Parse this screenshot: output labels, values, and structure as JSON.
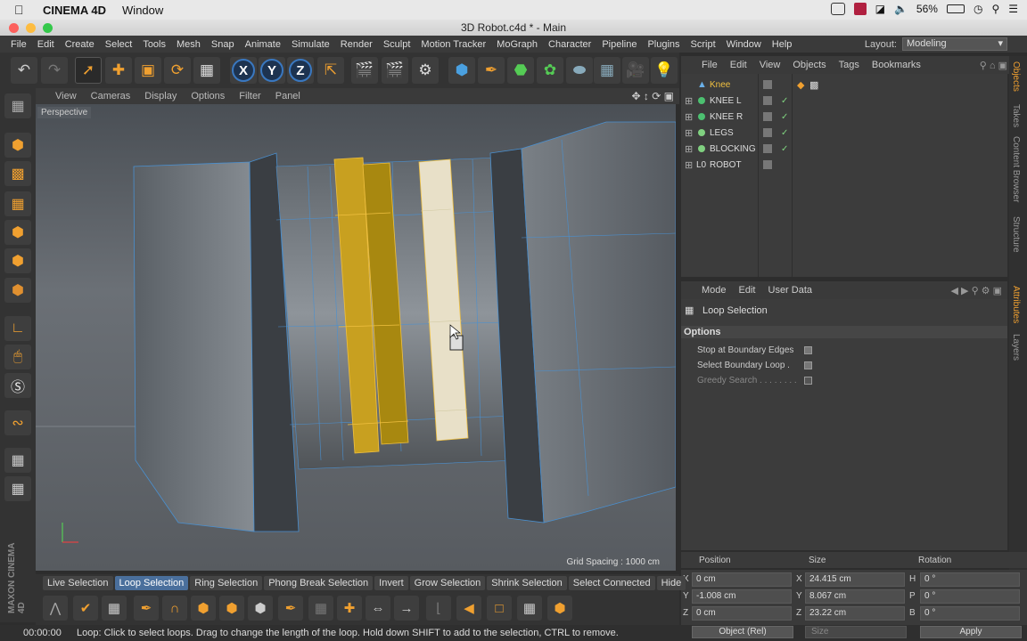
{
  "mac": {
    "app": "CINEMA 4D",
    "menu": "Window",
    "battery": "56%"
  },
  "window": {
    "title": "3D Robot.c4d * - Main"
  },
  "menu": [
    "File",
    "Edit",
    "Create",
    "Select",
    "Tools",
    "Mesh",
    "Snap",
    "Animate",
    "Simulate",
    "Render",
    "Sculpt",
    "Motion Tracker",
    "MoGraph",
    "Character",
    "Pipeline",
    "Plugins",
    "Script",
    "Window",
    "Help"
  ],
  "layout": {
    "label": "Layout:",
    "value": "Modeling"
  },
  "axis": {
    "x": "X",
    "y": "Y",
    "z": "Z"
  },
  "viewport": {
    "menu": [
      "View",
      "Cameras",
      "Display",
      "Options",
      "Filter",
      "Panel"
    ],
    "camera_label": "Perspective",
    "grid_spacing": "Grid Spacing : 1000 cm"
  },
  "objects": {
    "menu": [
      "File",
      "Edit",
      "View",
      "Objects",
      "Tags",
      "Bookmarks"
    ],
    "items": [
      {
        "name": "Knee",
        "color": "#f0c040"
      },
      {
        "name": "KNEE L",
        "color": "#ddd"
      },
      {
        "name": "KNEE R",
        "color": "#ddd"
      },
      {
        "name": "LEGS",
        "color": "#ddd"
      },
      {
        "name": "BLOCKING",
        "color": "#ddd"
      },
      {
        "name": "ROBOT",
        "color": "#ddd"
      }
    ]
  },
  "side_tabs": [
    "Objects",
    "Takes",
    "Content Browser",
    "Structure",
    "Attributes",
    "Layers"
  ],
  "attributes": {
    "menu": [
      "Mode",
      "Edit",
      "User Data"
    ],
    "tool_name": "Loop Selection",
    "section": "Options",
    "options": [
      {
        "label": "Stop at Boundary Edges"
      },
      {
        "label": "Select Boundary Loop ."
      },
      {
        "label": "Greedy Search . . . . . . . ."
      }
    ]
  },
  "coords": {
    "headers": [
      "Position",
      "Size",
      "Rotation"
    ],
    "rows": [
      {
        "pl": "X",
        "pv": "0 cm",
        "sl": "X",
        "sv": "24.415 cm",
        "rl": "H",
        "rv": "0 °"
      },
      {
        "pl": "Y",
        "pv": "-1.008 cm",
        "sl": "Y",
        "sv": "8.067 cm",
        "rl": "P",
        "rv": "0 °"
      },
      {
        "pl": "Z",
        "pv": "0 cm",
        "sl": "Z",
        "sv": "23.22 cm",
        "rl": "B",
        "rv": "0 °"
      }
    ],
    "mode": "Object (Rel)",
    "size_mode": "Size",
    "apply": "Apply"
  },
  "selection_tabs": [
    "Live Selection",
    "Loop Selection",
    "Ring Selection",
    "Phong Break Selection",
    "Invert",
    "Grow Selection",
    "Shrink Selection",
    "Select Connected",
    "Hide"
  ],
  "status": {
    "time": "00:00:00",
    "message": "Loop: Click to select loops. Drag to change the length of the loop. Hold down SHIFT to add to the selection, CTRL to remove."
  },
  "brand": "MAXON CINEMA 4D",
  "colors": {
    "accent": "#f0a030",
    "selection_yellow": "#c8a020",
    "selection_light": "#e8e0c8",
    "tab_active": "#4a6f9c"
  }
}
